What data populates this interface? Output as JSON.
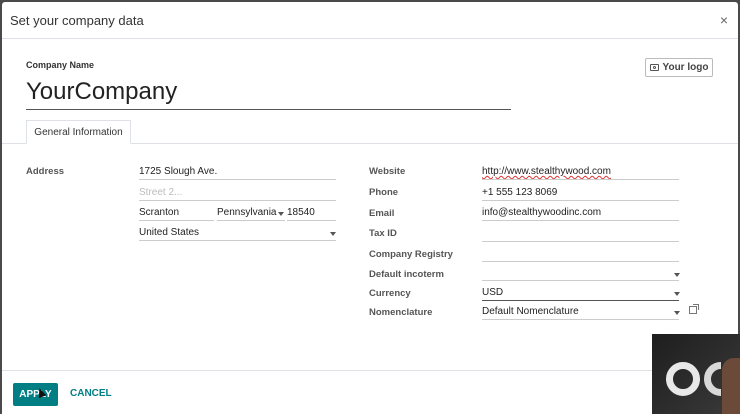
{
  "modal": {
    "title": "Set your company data",
    "close": "×"
  },
  "company": {
    "label": "Company Name",
    "name": "YourCompany",
    "logo_button": "Your logo"
  },
  "tabs": [
    {
      "label": "General Information"
    }
  ],
  "address": {
    "label": "Address",
    "street": "1725 Slough Ave.",
    "street2_placeholder": "Street 2...",
    "city": "Scranton",
    "state": "Pennsylvania",
    "zip": "18540",
    "country": "United States"
  },
  "right_fields": {
    "website": {
      "label": "Website",
      "value": "http://www.stealthywood.com"
    },
    "phone": {
      "label": "Phone",
      "value": "+1 555 123 8069"
    },
    "email": {
      "label": "Email",
      "value": "info@stealthywoodinc.com"
    },
    "tax_id": {
      "label": "Tax ID",
      "value": ""
    },
    "company_registry": {
      "label": "Company Registry",
      "value": ""
    },
    "incoterm": {
      "label": "Default incoterm",
      "value": ""
    },
    "currency": {
      "label": "Currency",
      "value": "USD"
    },
    "nomenclature": {
      "label": "Nomenclature",
      "value": "Default Nomenclature"
    }
  },
  "footer": {
    "apply": "APPLY",
    "cancel": "CANCEL"
  },
  "icons": {
    "close": "close-icon",
    "camera": "camera-icon",
    "external_link": "external-link-icon"
  },
  "colors": {
    "primary": "#017e84"
  }
}
